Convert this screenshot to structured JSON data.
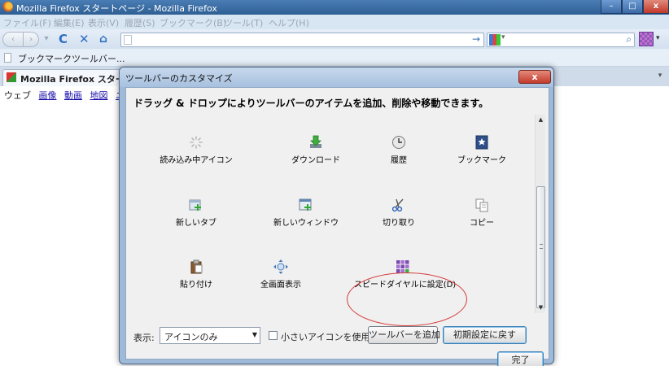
{
  "window": {
    "title": "Mozilla Firefox スタートページ - Mozilla Firefox",
    "min": "–",
    "max": "□",
    "close": "x"
  },
  "menubar": [
    "ファイル(F)",
    "編集(E)",
    "表示(V)",
    "履歴(S)",
    "ブックマーク(B)",
    "ツール(T)",
    "ヘルプ(H)"
  ],
  "navbar": {
    "back": "‹",
    "forward": "›",
    "dropdown": "▾",
    "reload": "C",
    "stop": "✕",
    "home": "⌂",
    "go": "→",
    "search_icon": "⌕",
    "dropdown_small": "▾"
  },
  "bookmarks": {
    "label": "ブックマークツールバー..."
  },
  "tab": {
    "label": "Mozilla Firefox スタートペ",
    "list": "▾"
  },
  "content": {
    "links": [
      "ウェブ",
      "画像",
      "動画",
      "地図",
      "ニュ"
    ]
  },
  "dialog": {
    "title": "ツールバーのカスタマイズ",
    "close": "x",
    "instructions": "ドラッグ & ドロップによりツールバーのアイテムを追加、削除や移動できます。",
    "items": [
      {
        "label": "読み込み中アイコン",
        "icon": "throbber-icon"
      },
      {
        "label": "ダウンロード",
        "icon": "download-icon"
      },
      {
        "label": "履歴",
        "icon": "history-icon"
      },
      {
        "label": "ブックマーク",
        "icon": "bookmark-icon"
      },
      {
        "label": "新しいタブ",
        "icon": "new-tab-icon"
      },
      {
        "label": "新しいウィンドウ",
        "icon": "new-window-icon"
      },
      {
        "label": "切り取り",
        "icon": "cut-icon"
      },
      {
        "label": "コピー",
        "icon": "copy-icon"
      },
      {
        "label": "貼り付け",
        "icon": "paste-icon"
      },
      {
        "label": "全画面表示",
        "icon": "fullscreen-icon"
      },
      {
        "label": "スピードダイヤルに設定(D)",
        "icon": "speed-dial-icon"
      }
    ],
    "scroll": {
      "up": "▲",
      "down": "▼"
    },
    "show_label": "表示:",
    "show_value": "アイコンのみ",
    "small_icons_label": "小さいアイコンを使用",
    "small_icons_checked": false,
    "add_toolbar": "ツールバーを追加",
    "restore": "初期設定に戻す",
    "done": "完了"
  },
  "colors": {
    "highlight": "#d63a3a",
    "titlebar": "#2e5f94"
  }
}
